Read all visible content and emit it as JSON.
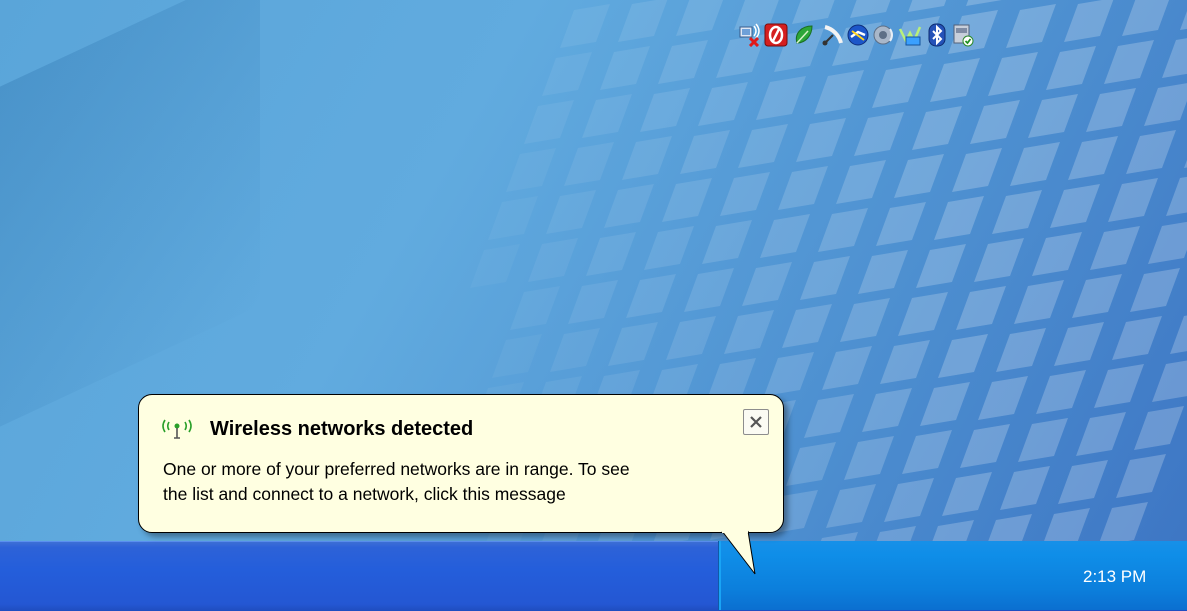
{
  "balloon": {
    "title": "Wireless networks detected",
    "line1": "One or more of your preferred networks are in range. To see",
    "line2": "the list and connect to a network, click this message",
    "close_icon": "close-x-icon",
    "title_icon": "wireless-signal-icon"
  },
  "tray": {
    "time": "2:13 PM",
    "icons": [
      "network-disconnected-icon",
      "antivirus-shield-icon",
      "green-leaf-icon",
      "satellite-dish-icon",
      "network-connection-icon",
      "speaker-volume-icon",
      "dvd-writer-icon",
      "bluetooth-icon",
      "safely-remove-hardware-icon"
    ]
  },
  "colors": {
    "balloon_bg": "#ffffe1",
    "taskbar": "#245edb",
    "tray": "#0f8ee8"
  }
}
